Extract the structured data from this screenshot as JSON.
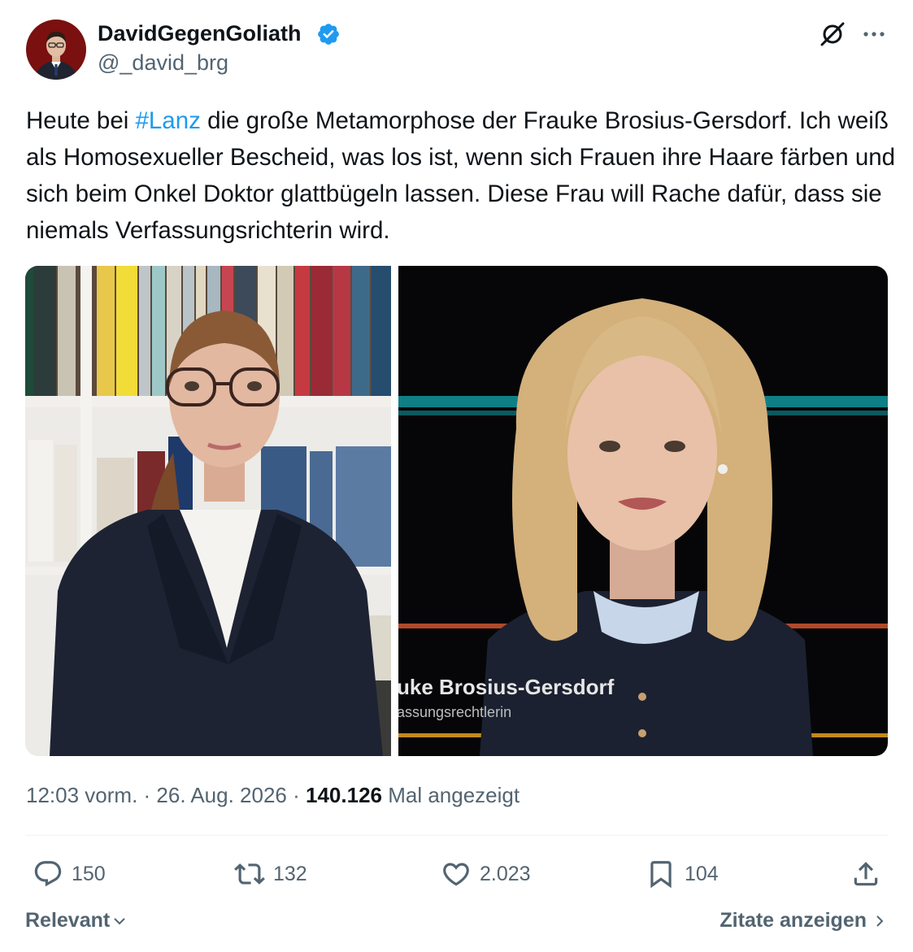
{
  "author": {
    "name": "DavidGegenGoliath",
    "handle": "@_david_brg",
    "avatar_icon": "person-avatar",
    "verified_icon": "verified-badge-icon"
  },
  "tweet": {
    "text_before_tag": "Heute bei ",
    "hashtag": "#Lanz",
    "text_after_tag": " die große Metamorphose der Frauke Brosius-Gersdorf. Ich weiß als Homosexueller Bescheid, was los ist, wenn sich Frauen ihre Haare färben und sich beim Onkel Doktor glattbügeln lassen. Diese Frau will Rache dafür, dass sie niemals Verfassungsrichterin wird."
  },
  "media": {
    "right": {
      "lower_third_name": "uke Brosius-Gersdorf",
      "lower_third_title": "assungsrechtlerin"
    }
  },
  "meta": {
    "time": "12:03 vorm.",
    "separator1": " · ",
    "date": "26. Aug. 2026",
    "separator2": " · ",
    "views_count": "140.126",
    "views_label": " Mal angezeigt"
  },
  "actions": {
    "replies": "150",
    "reposts": "132",
    "likes": "2.023",
    "bookmarks": "104"
  },
  "footer": {
    "sort_label": "Relevant",
    "quotes_label": "Zitate anzeigen"
  },
  "colors": {
    "accent": "#1d9bf0",
    "secondary_text": "#536471",
    "primary_text": "#0f1419"
  }
}
